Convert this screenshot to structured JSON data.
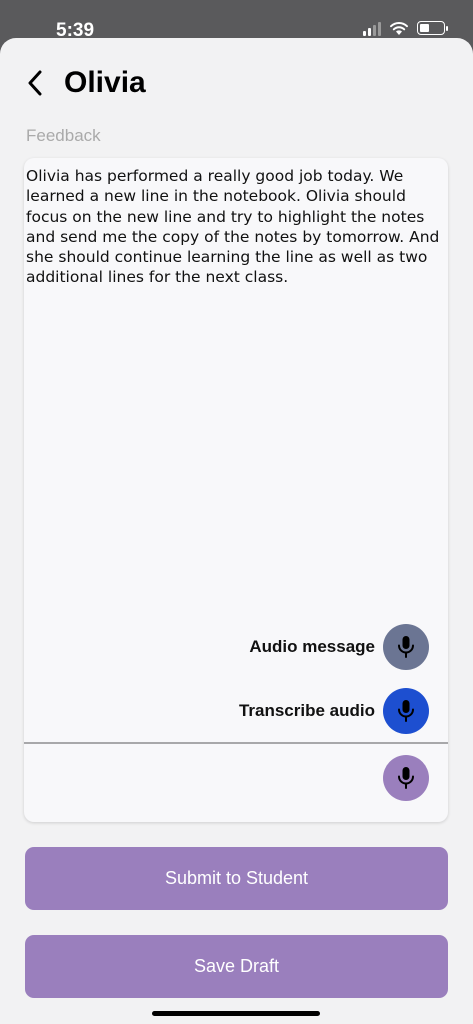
{
  "status_bar": {
    "time": "5:39"
  },
  "header": {
    "title": "Olivia",
    "back_icon": "chevron-left-icon"
  },
  "feedback": {
    "label": "Feedback",
    "text": "Olivia has performed a really good job today. We learned a new line in the notebook. Olivia should focus on the new line and try to highlight the notes and send me the copy of the notes by tomorrow. And she should continue learning the line as well as two additional lines for the next class."
  },
  "actions": {
    "audio_message_label": "Audio message",
    "transcribe_audio_label": "Transcribe audio",
    "icon": "microphone-icon"
  },
  "buttons": {
    "submit_label": "Submit to Student",
    "draft_label": "Save Draft"
  },
  "colors": {
    "audio_message_mic": "#6b7593",
    "transcribe_mic": "#1d4fd0",
    "input_mic": "#9a7fbd",
    "primary_button": "#9a7fbd"
  }
}
